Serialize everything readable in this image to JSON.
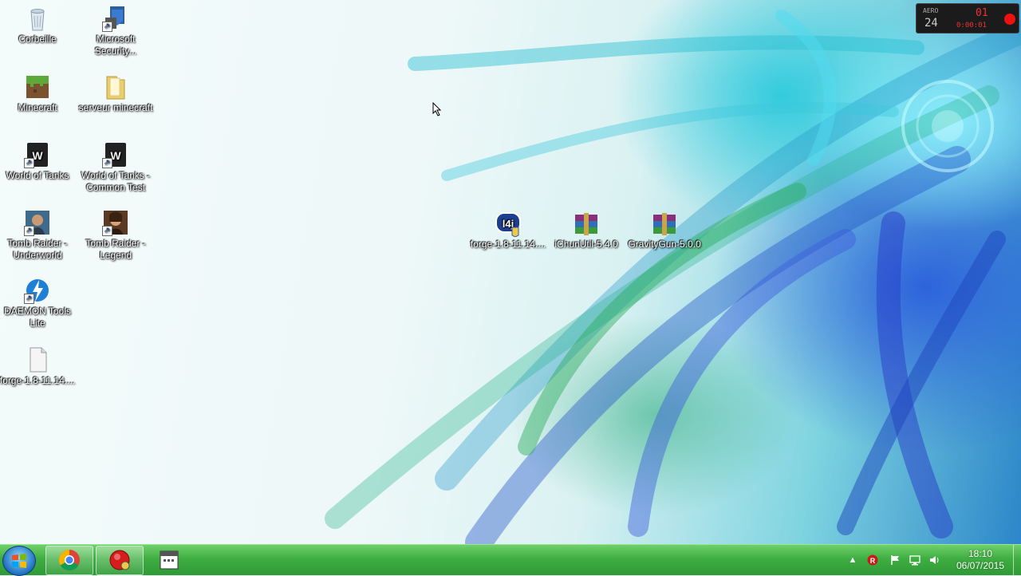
{
  "desktop": {
    "icons": [
      {
        "label": "Corbeille",
        "icon": "recycle-bin-icon"
      },
      {
        "label": "Microsoft Security...",
        "icon": "security-shield-icon"
      },
      {
        "label": "Minecraft",
        "icon": "minecraft-grass-block-icon"
      },
      {
        "label": "serveur minecraft",
        "icon": "folder-icon"
      },
      {
        "label": "World of Tanks",
        "icon": "world-of-tanks-icon"
      },
      {
        "label": "World of Tanks - Common Test",
        "icon": "world-of-tanks-icon"
      },
      {
        "label": "Tomb Raider - Underworld",
        "icon": "tomb-raider-icon"
      },
      {
        "label": "Tomb Raider - Legend",
        "icon": "tomb-raider-icon"
      },
      {
        "label": "DAEMON Tools Lite",
        "icon": "daemon-tools-icon"
      },
      {
        "label": "forge-1.8-11.14....",
        "icon": "blank-file-icon"
      },
      {
        "label": "forge-1.8-11.14....",
        "icon": "java-installer-icon"
      },
      {
        "label": "iChunUtil-5.4.0",
        "icon": "winrar-archive-icon"
      },
      {
        "label": "GravityGun-5.0.0",
        "icon": "winrar-archive-icon"
      }
    ]
  },
  "fraps": {
    "aero": "AERO",
    "fps": "24",
    "counter": "01",
    "timer": "0:00:01"
  },
  "taskbar": {
    "pinned": [
      {
        "name": "chrome",
        "icon": "chrome-icon"
      },
      {
        "name": "fraps",
        "icon": "fraps-record-icon"
      },
      {
        "name": "calendar-app",
        "icon": "calendar-window-icon"
      }
    ],
    "tray": {
      "time": "18:10",
      "date": "06/07/2015"
    }
  },
  "colors": {
    "taskbar": "#3fae42",
    "accent_blue": "#1e6fc0",
    "record_red": "#e11111"
  }
}
